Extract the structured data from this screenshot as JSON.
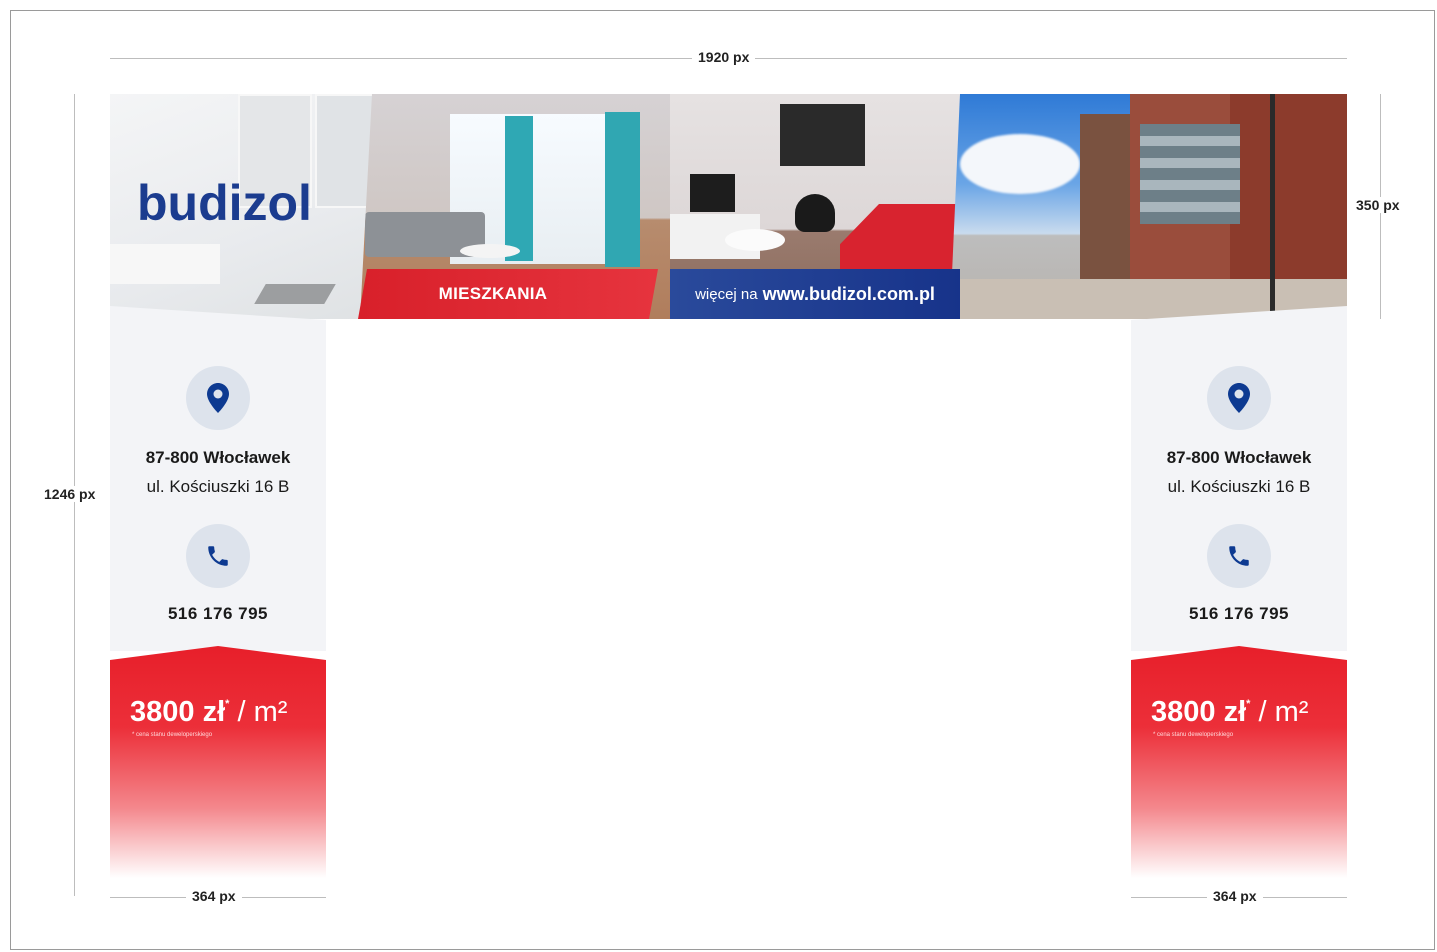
{
  "dimensions": {
    "top_width": "1920 px",
    "banner_height": "350 px",
    "total_height": "1246 px",
    "left_pillar_width": "364 px",
    "right_pillar_width": "364 px"
  },
  "banner": {
    "logo": "budizol",
    "tag_label": "MIESZKANIA",
    "more_prefix": "więcej na",
    "url": "www.budizol.com.pl"
  },
  "pillars": {
    "left": {
      "address_line1": "87-800 Włocławek",
      "address_line2": "ul. Kościuszki 16 B",
      "phone": "516 176 795",
      "price_value": "3800 zł",
      "price_mark": "*",
      "price_unit": "/ m²",
      "price_note": "* cena stanu deweloperskiego"
    },
    "right": {
      "address_line1": "87-800 Włocławek",
      "address_line2": "ul. Kościuszki 16 B",
      "phone": "516 176 795",
      "price_value": "3800 zł",
      "price_mark": "*",
      "price_unit": "/ m²",
      "price_note": "* cena stanu deweloperskiego"
    }
  },
  "colors": {
    "brand_blue": "#1b3c8f",
    "brand_red": "#e71f2a",
    "icon_circle": "#dde3ec"
  },
  "icons": [
    "location-pin-icon",
    "phone-icon"
  ]
}
